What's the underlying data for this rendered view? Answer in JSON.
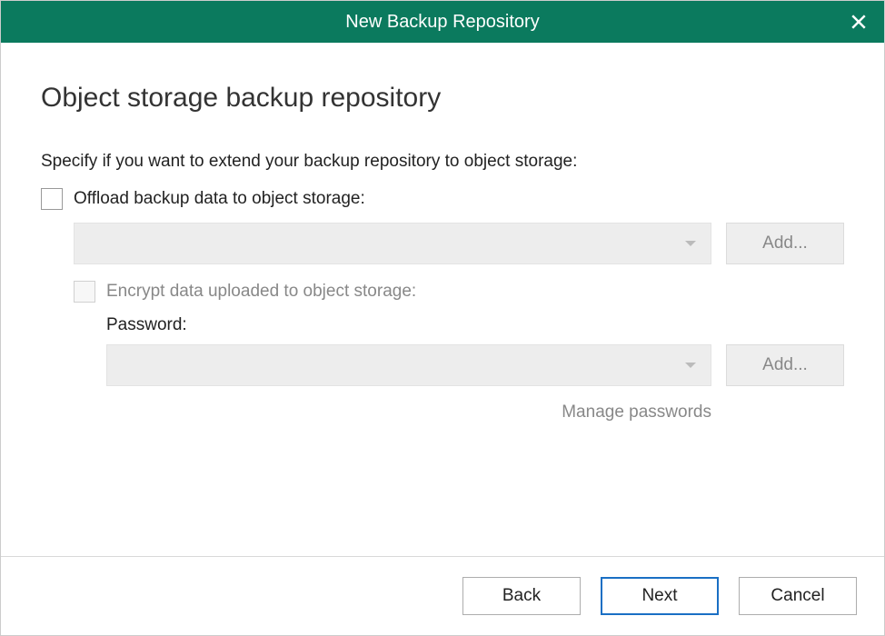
{
  "titlebar": {
    "title": "New Backup Repository"
  },
  "page": {
    "heading": "Object storage backup repository",
    "instruction": "Specify if you want to extend your backup repository to object storage:"
  },
  "offload": {
    "checkbox_label": "Offload backup data to object storage:",
    "dropdown_value": "",
    "add_button": "Add..."
  },
  "encrypt": {
    "checkbox_label": "Encrypt data uploaded to object storage:",
    "password_label": "Password:",
    "dropdown_value": "",
    "add_button": "Add...",
    "manage_link": "Manage passwords"
  },
  "footer": {
    "back": "Back",
    "next": "Next",
    "cancel": "Cancel"
  }
}
